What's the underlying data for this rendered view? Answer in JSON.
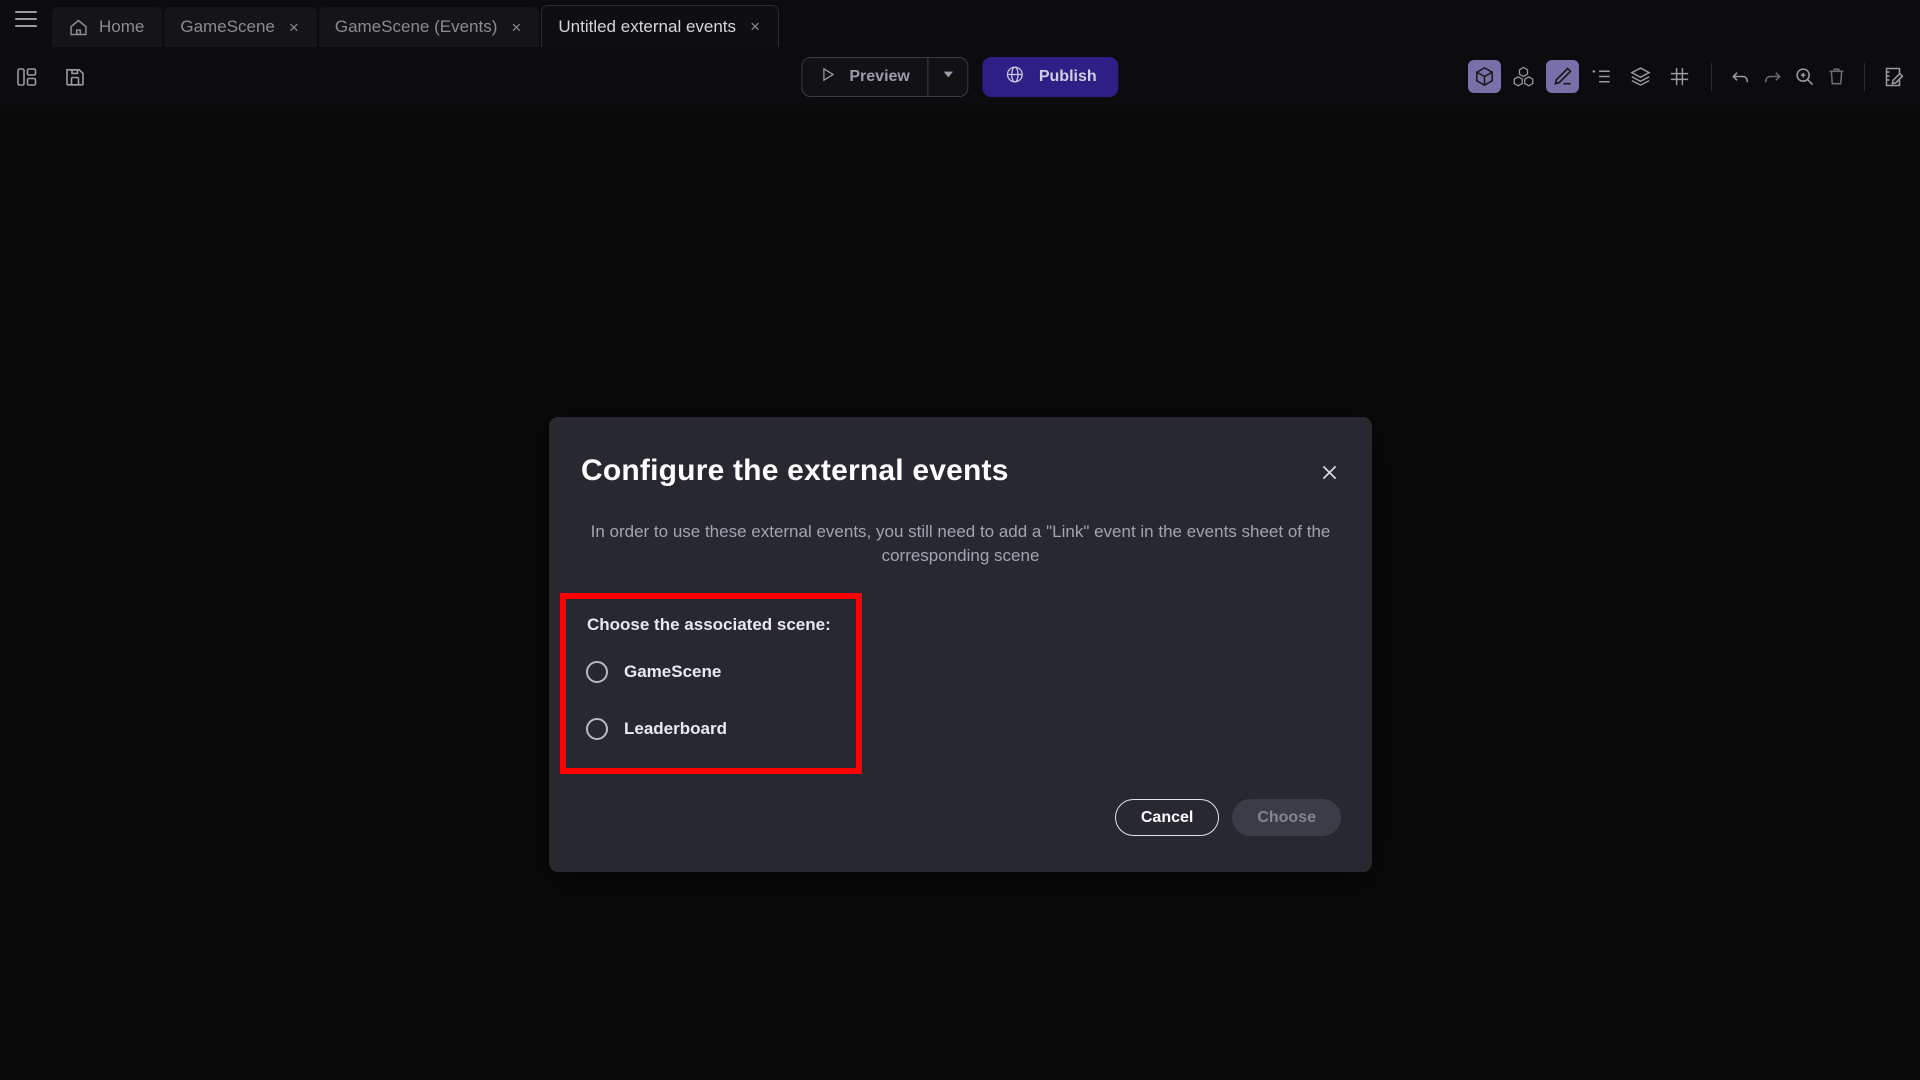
{
  "window": {
    "menu_icon": "hamburger-menu-icon"
  },
  "tabs": [
    {
      "label": "Home",
      "icon": "home-icon",
      "closable": false,
      "active": false
    },
    {
      "label": "GameScene",
      "icon": "",
      "closable": true,
      "active": false
    },
    {
      "label": "GameScene (Events)",
      "icon": "",
      "closable": true,
      "active": false
    },
    {
      "label": "Untitled external events",
      "icon": "",
      "closable": true,
      "active": true
    }
  ],
  "tab_close_glyph": "×",
  "toolbar": {
    "left_icons": [
      {
        "name": "panel-layout-icon"
      },
      {
        "name": "save-icon"
      }
    ],
    "preview_label": "Preview",
    "preview_icon": "play-icon",
    "preview_caret_icon": "chevron-down-icon",
    "publish_label": "Publish",
    "publish_icon": "globe-icon",
    "publish_color": "#2d1f86",
    "right_icons": [
      {
        "name": "object-cube-icon",
        "active": true
      },
      {
        "name": "object-group-icon",
        "active": false
      },
      {
        "name": "edit-pencil-icon",
        "active": true
      },
      {
        "name": "properties-list-icon",
        "active": false
      },
      {
        "name": "layers-icon",
        "active": false
      },
      {
        "name": "grid-icon",
        "active": false
      }
    ],
    "right_actions": [
      {
        "name": "undo-icon"
      },
      {
        "name": "redo-icon"
      },
      {
        "name": "zoom-in-icon"
      },
      {
        "name": "delete-trash-icon"
      }
    ],
    "notes_icon": "edit-notes-icon"
  },
  "dialog": {
    "title": "Configure the external events",
    "close_glyph": "×",
    "description": "In order to use these external events, you still need to add a \"Link\" event in the events sheet of the corresponding scene",
    "group_label": "Choose the associated scene:",
    "highlight_color": "#ff0000",
    "options": [
      {
        "label": "GameScene",
        "selected": false
      },
      {
        "label": "Leaderboard",
        "selected": false
      }
    ],
    "cancel_label": "Cancel",
    "choose_label": "Choose",
    "choose_disabled": true
  }
}
